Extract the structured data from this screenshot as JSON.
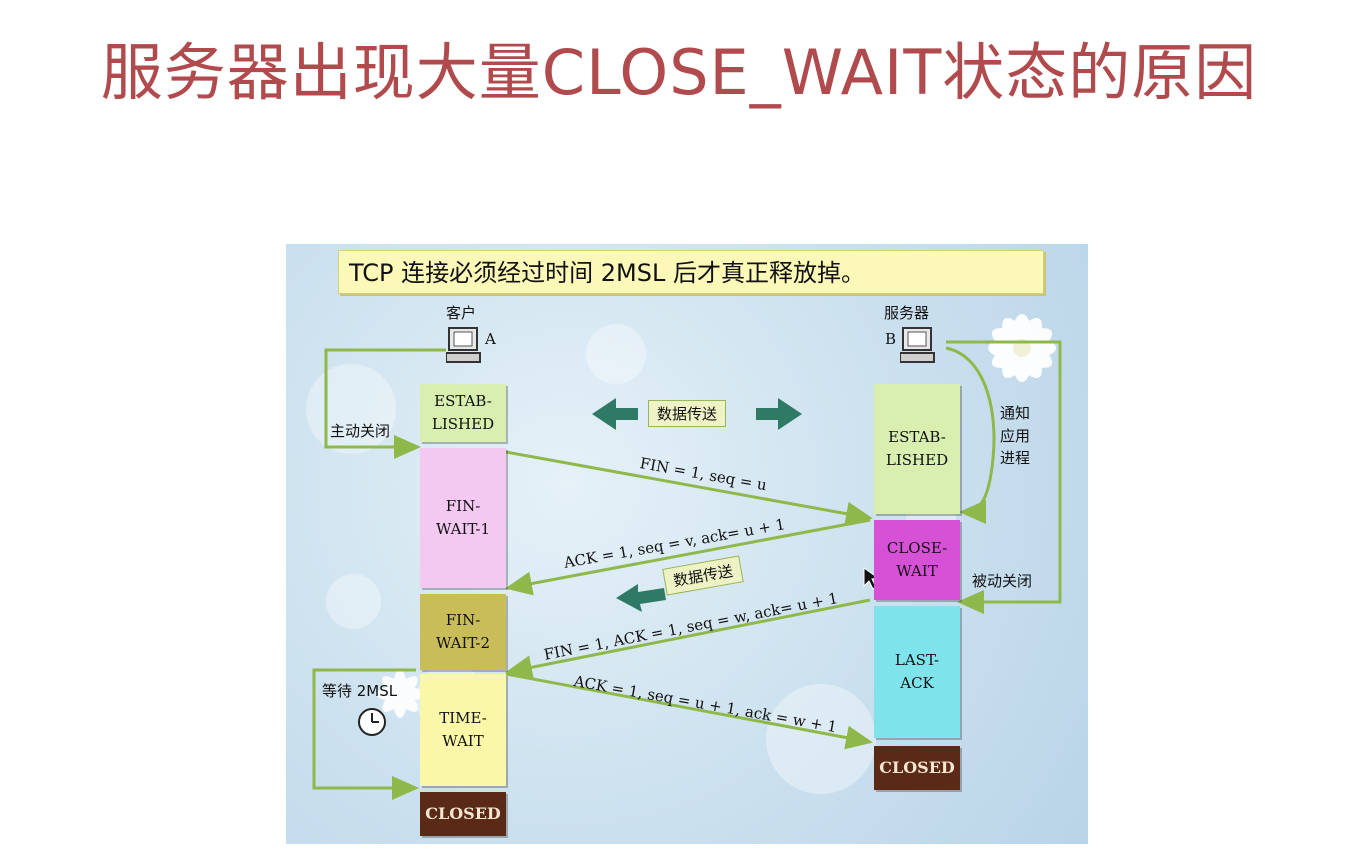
{
  "title": "服务器出现大量CLOSE_WAIT状态的原因",
  "diagram": {
    "banner": "TCP 连接必须经过时间 2MSL 后才真正释放掉。",
    "client": {
      "name": "客户",
      "letter": "A"
    },
    "server": {
      "name": "服务器",
      "letter": "B"
    },
    "client_states": [
      {
        "label": "ESTAB-\nLISHED",
        "color": "#d9efb0"
      },
      {
        "label": "FIN-\nWAIT-1",
        "color": "#f3c8f1"
      },
      {
        "label": "FIN-\nWAIT-2",
        "color": "#c9bd5a"
      },
      {
        "label": "TIME-\nWAIT",
        "color": "#fbf7a8"
      },
      {
        "label": "CLOSED",
        "color": "#5a2a16"
      }
    ],
    "server_states": [
      {
        "label": "ESTAB-\nLISHED",
        "color": "#d9efb0"
      },
      {
        "label": "CLOSE-\nWAIT",
        "color": "#d651d6"
      },
      {
        "label": "LAST-\nACK",
        "color": "#7fe3ec"
      },
      {
        "label": "CLOSED",
        "color": "#5a2a16"
      }
    ],
    "side_labels": {
      "active_close": "主动关闭",
      "notify_app": "通知\n应用\n进程",
      "passive_close": "被动关闭",
      "wait_2msl": "等待 2MSL"
    },
    "data_transfer_label": "数据传送",
    "messages": [
      "FIN = 1, seq = u",
      "ACK = 1, seq = v, ack= u + 1",
      "FIN = 1, ACK = 1, seq = w, ack= u + 1",
      "ACK = 1, seq = u + 1, ack = w + 1"
    ],
    "icons": [
      "computer-icon",
      "clock-icon",
      "double-arrow-icon",
      "left-arrow-icon",
      "cursor-icon"
    ]
  }
}
